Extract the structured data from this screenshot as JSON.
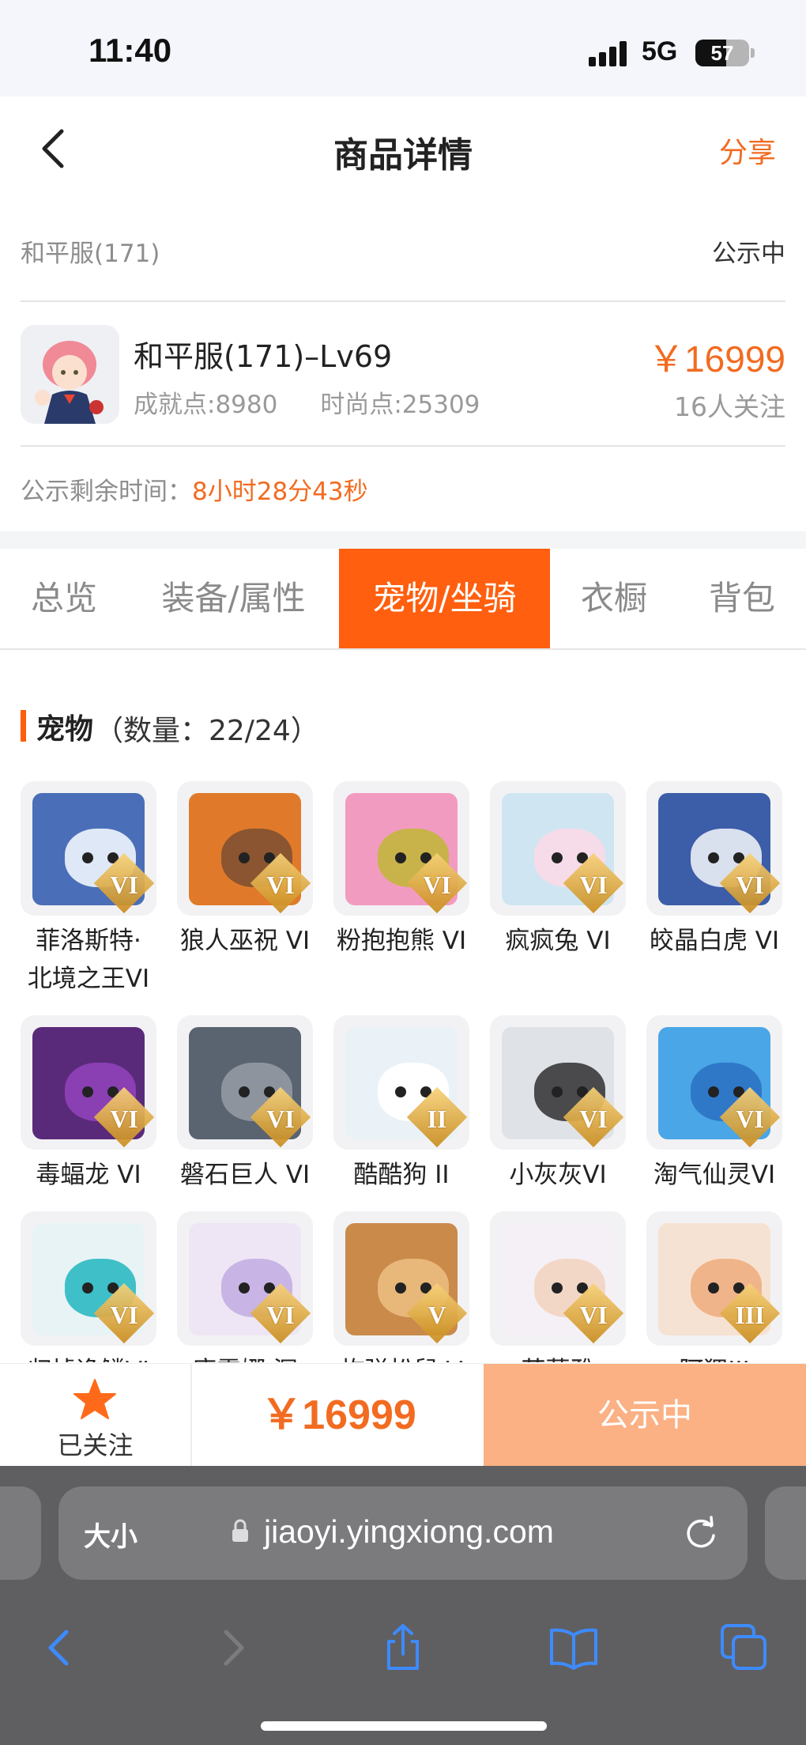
{
  "status_bar": {
    "time": "11:40",
    "network": "5G",
    "battery": "57"
  },
  "header": {
    "title": "商品详情",
    "share": "分享"
  },
  "server": {
    "name": "和平服(171)",
    "status": "公示中"
  },
  "product": {
    "name": "和平服(171)–Lv69",
    "achievement": "成就点:8980",
    "fashion": "时尚点:25309",
    "price": "￥16999",
    "followers": "16人关注"
  },
  "countdown": {
    "label": "公示剩余时间：",
    "value": "8小时28分43秒"
  },
  "tabs": [
    {
      "label": "总览",
      "active": false
    },
    {
      "label": "装备/属性",
      "active": false
    },
    {
      "label": "宠物/坐骑",
      "active": true
    },
    {
      "label": "衣橱",
      "active": false
    },
    {
      "label": "背包",
      "active": false
    }
  ],
  "pets_section": {
    "title": "宠物",
    "count": "（数量：22/24）"
  },
  "pets": [
    {
      "name": "菲洛斯特·\n北境之王VI",
      "rank": "VI",
      "bg": "#4a6fb8",
      "face": "#dfe8f6",
      "icon": "ice-dragon-icon"
    },
    {
      "name": "狼人巫祝 VI",
      "rank": "VI",
      "bg": "#e07a2a",
      "face": "#8a5530",
      "icon": "wolf-shaman-icon"
    },
    {
      "name": "粉抱抱熊 VI",
      "rank": "VI",
      "bg": "#f29bc0",
      "face": "#c8b34a",
      "icon": "pink-bear-icon"
    },
    {
      "name": "疯疯兔 VI",
      "rank": "VI",
      "bg": "#cfe6f2",
      "face": "#f6dbe8",
      "icon": "crazy-rabbit-icon"
    },
    {
      "name": "皎晶白虎 VI",
      "rank": "VI",
      "bg": "#3c5da8",
      "face": "#d9e0ee",
      "icon": "white-tiger-icon"
    },
    {
      "name": "毒蝠龙 VI",
      "rank": "VI",
      "bg": "#5a2a7a",
      "face": "#8a3fb2",
      "icon": "venom-bat-dragon-icon"
    },
    {
      "name": "磐石巨人 VI",
      "rank": "VI",
      "bg": "#5a6370",
      "face": "#8d949e",
      "icon": "rock-giant-icon"
    },
    {
      "name": "酷酷狗 II",
      "rank": "II",
      "bg": "#eaf2f8",
      "face": "#ffffff",
      "icon": "cool-dog-icon"
    },
    {
      "name": "小灰灰VI",
      "rank": "VI",
      "bg": "#dfe3e8",
      "face": "#4a4a4c",
      "icon": "little-grey-wolf-icon"
    },
    {
      "name": "淘气仙灵VI",
      "rank": "VI",
      "bg": "#4aa6e6",
      "face": "#2f78c8",
      "icon": "naughty-sprite-icon"
    },
    {
      "name": "归墟逸鳞VI",
      "rank": "VI",
      "bg": "#e8f3f6",
      "face": "#3fbfc8",
      "icon": "azure-dragon-icon"
    },
    {
      "name": "唐霜娜·深",
      "rank": "VI",
      "bg": "#eee6f4",
      "face": "#c9b4e6",
      "icon": "frost-maiden-icon"
    },
    {
      "name": "炸弹松鼠 V",
      "rank": "V",
      "bg": "#c98a4a",
      "face": "#e8b77a",
      "icon": "bomb-squirrel-icon"
    },
    {
      "name": "芙蕾雅",
      "rank": "VI",
      "bg": "#f4f0f6",
      "face": "#f3d7c6",
      "icon": "freya-valkyrie-icon"
    },
    {
      "name": "阿狸III",
      "rank": "III",
      "bg": "#f6e2d2",
      "face": "#f0b48a",
      "icon": "ali-fox-icon"
    }
  ],
  "action_bar": {
    "follow_label": "已关注",
    "price": "￥16999",
    "status": "公示中"
  },
  "browser": {
    "text_size": "大小",
    "url": "jiaoyi.yingxiong.com"
  },
  "colors": {
    "accent": "#f26b21",
    "tab_active": "#ff5f0f",
    "status_button": "#fbb184"
  }
}
